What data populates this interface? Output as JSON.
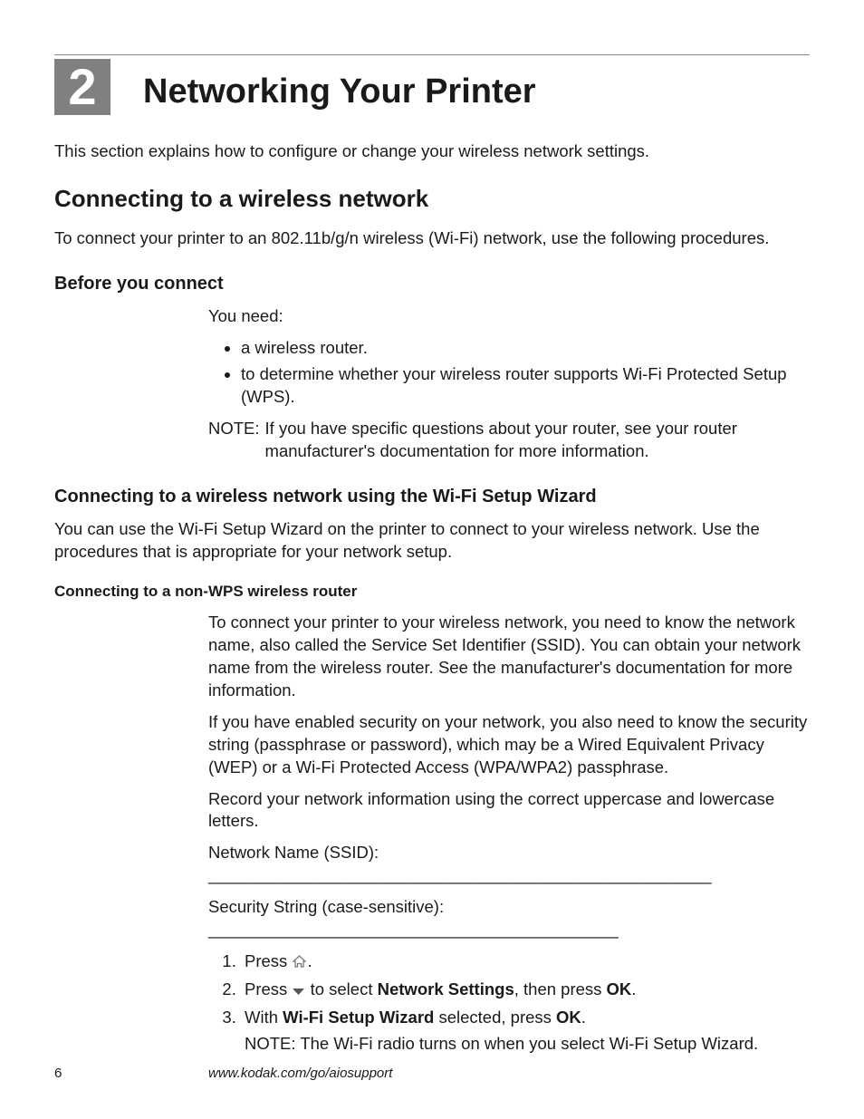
{
  "chapter": {
    "number": "2",
    "title": "Networking Your Printer",
    "intro": "This section explains how to configure or change your wireless network settings."
  },
  "section1": {
    "title": "Connecting to a wireless network",
    "intro": "To connect your printer to an 802.11b/g/n wireless (Wi-Fi) network, use the following procedures."
  },
  "before": {
    "title": "Before you connect",
    "lead": "You need:",
    "bullet1": "a wireless router.",
    "bullet2": "to determine whether your wireless router supports Wi-Fi Protected Setup (WPS).",
    "note_label": "NOTE:",
    "note_text": "If you have specific questions about your router, see your router manufacturer's documentation for more information."
  },
  "wizard": {
    "title": "Connecting to a wireless network using the Wi-Fi Setup Wizard",
    "intro": "You can use the Wi-Fi Setup Wizard on the printer to connect to your wireless network. Use the procedures that is appropriate for your network setup."
  },
  "nonwps": {
    "title": "Connecting to a non-WPS wireless router",
    "p1": "To connect your printer to your wireless network, you need to know the network name, also called the Service Set Identifier (SSID). You can obtain your network name from the wireless router. See the manufacturer's documentation for more information.",
    "p2": "If you have enabled security on your network, you also need to know the security string (passphrase or password), which may be a Wired Equivalent Privacy (WEP) or a Wi-Fi Protected Access (WPA/WPA2) passphrase.",
    "p3": "Record your network information using the correct uppercase and lowercase letters.",
    "ssid_line": "Network Name (SSID):   ______________________________________________________",
    "security_line": "Security String (case-sensitive): ____________________________________________",
    "step1_prefix": "Press ",
    "step1_suffix": ".",
    "step2_prefix": "Press ",
    "step2_mid": " to select ",
    "step2_bold1": "Network Settings",
    "step2_mid2": ", then press ",
    "step2_bold2": "OK",
    "step2_suffix": ".",
    "step3_prefix": "With ",
    "step3_bold1": "Wi-Fi Setup Wizard",
    "step3_mid": " selected, press ",
    "step3_bold2": "OK",
    "step3_suffix": ".",
    "step_note": "NOTE: The Wi-Fi radio turns on when you select Wi-Fi Setup Wizard."
  },
  "footer": {
    "page": "6",
    "url": "www.kodak.com/go/aiosupport"
  }
}
